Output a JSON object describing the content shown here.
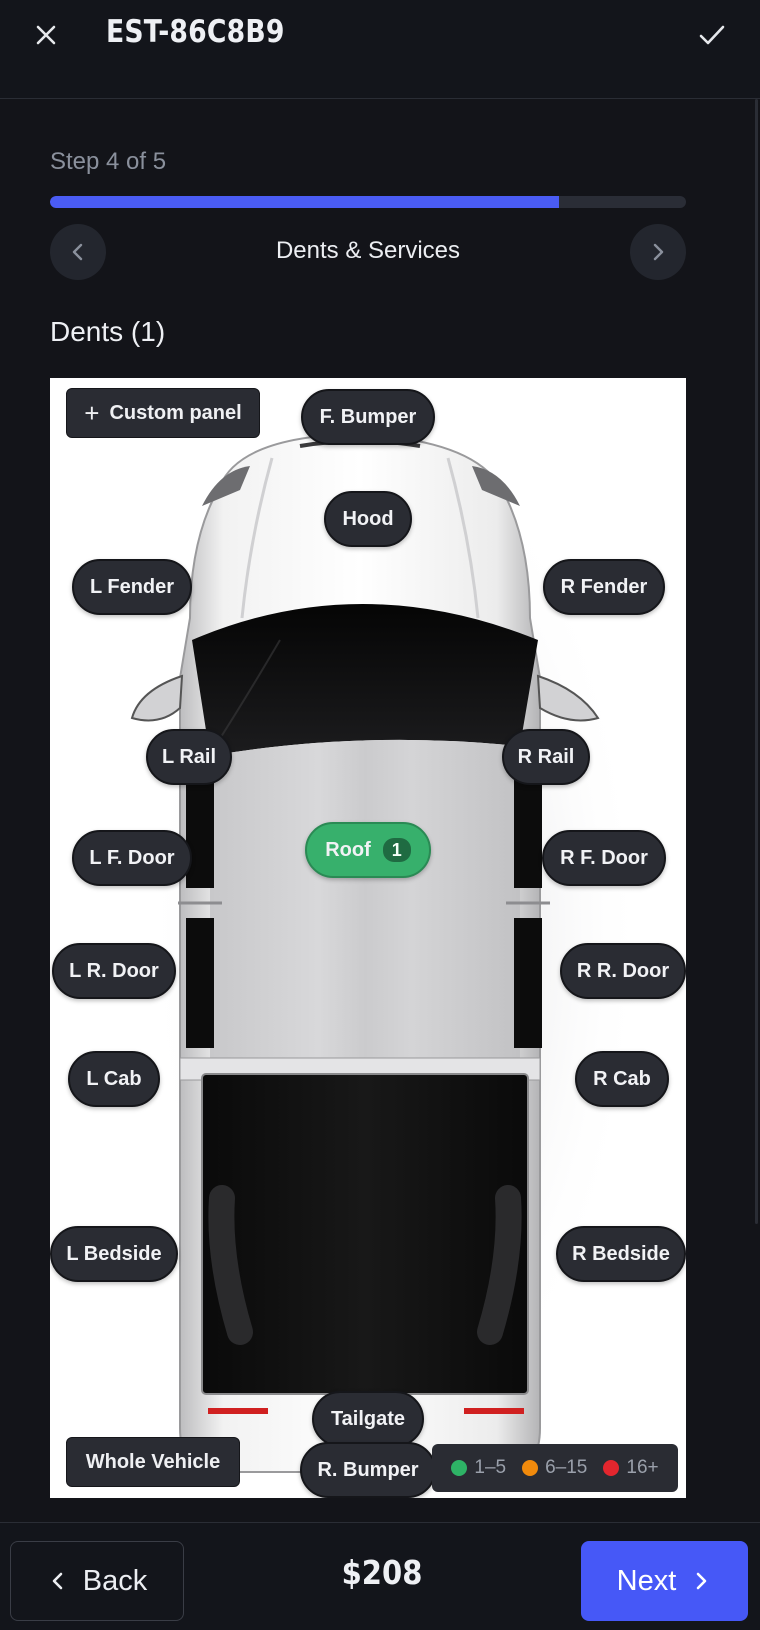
{
  "header": {
    "title": "EST-86C8B9",
    "close_icon": "close-icon",
    "confirm_icon": "check-icon"
  },
  "progress": {
    "step_label": "Step 4 of 5",
    "fraction": 0.8,
    "section_title": "Dents & Services",
    "prev_icon": "chevron-left-icon",
    "next_icon": "chevron-right-icon"
  },
  "dents": {
    "heading": "Dents (1)",
    "custom_panel_label": "Custom panel",
    "whole_vehicle_label": "Whole Vehicle",
    "panels": {
      "f_bumper": "F. Bumper",
      "hood": "Hood",
      "l_fender": "L Fender",
      "r_fender": "R Fender",
      "l_rail": "L Rail",
      "r_rail": "R Rail",
      "roof": "Roof",
      "roof_count": "1",
      "l_f_door": "L F. Door",
      "r_f_door": "R F. Door",
      "l_r_door": "L R. Door",
      "r_r_door": "R R. Door",
      "l_cab": "L Cab",
      "r_cab": "R Cab",
      "l_bedside": "L Bedside",
      "r_bedside": "R Bedside",
      "tailgate": "Tailgate",
      "r_bumper": "R. Bumper"
    },
    "legend": [
      {
        "label": "1–5",
        "color": "#2eb366"
      },
      {
        "label": "6–15",
        "color": "#f08a0c"
      },
      {
        "label": "16+",
        "color": "#e3262e"
      }
    ]
  },
  "footer": {
    "back_label": "Back",
    "price": "$208",
    "next_label": "Next"
  }
}
